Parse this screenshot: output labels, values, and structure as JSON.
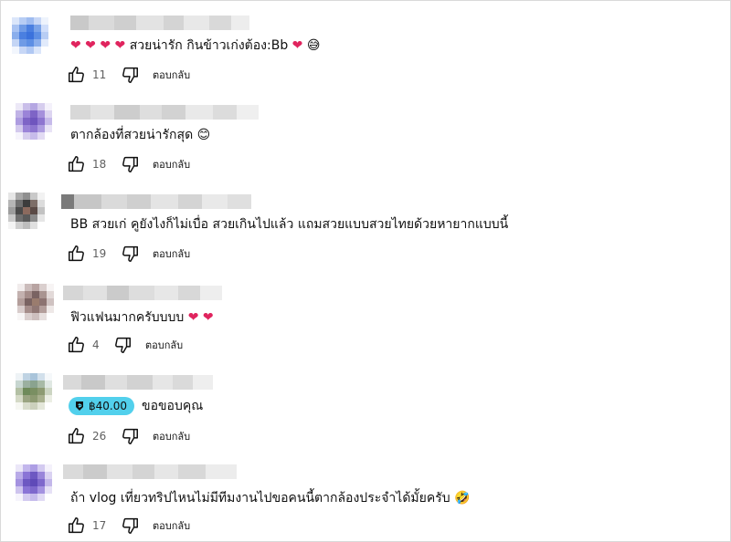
{
  "comments": [
    {
      "text": "สวยน่ารัก กินข้าวเก่งต้อง:Bb",
      "likes": "11",
      "reply": "ตอบกลับ",
      "avatar_colors": [
        "#6f9be6",
        "#4a7fe0"
      ]
    },
    {
      "text": "ตากล้องที่สวยน่ารักสุด",
      "likes": "18",
      "reply": "ตอบกลับ",
      "avatar_colors": [
        "#9b84d8",
        "#7e64c6"
      ]
    },
    {
      "text": "BB สวยเก่ คูยังไงก็ไม่เบื่อ สวยเกินไปแล้ว แถมสวยแบบสวยไทยด้วยหายากแบบนี้",
      "likes": "19",
      "reply": "ตอบกลับ",
      "avatar_colors": [
        "#6f6f6f",
        "#3c3c3c"
      ]
    },
    {
      "text": "ฟิวแฟนมากครับบบบ",
      "likes": "4",
      "reply": "ตอบกลับ",
      "avatar_colors": [
        "#a58d8a",
        "#7a6362"
      ]
    },
    {
      "text": "ขอขอบคุณ",
      "likes": "26",
      "reply": "ตอบกลับ",
      "thanks_amount": "฿40.00",
      "avatar_colors": [
        "#9bb0a0",
        "#6e8a5a"
      ]
    },
    {
      "text": "ถ้า vlog เที่ยวทริปไหนไม่มีทีมงานไปขอคนนี้ตากล้องประจำได้มั้ยครับ",
      "likes": "17",
      "reply": "ตอบกลับ",
      "avatar_colors": [
        "#8a74d6",
        "#6d58c2"
      ]
    }
  ],
  "icons": {
    "like": "like-icon",
    "dislike": "dislike-icon",
    "heart": "heart-icon",
    "thanks": "thanks-badge-icon"
  }
}
